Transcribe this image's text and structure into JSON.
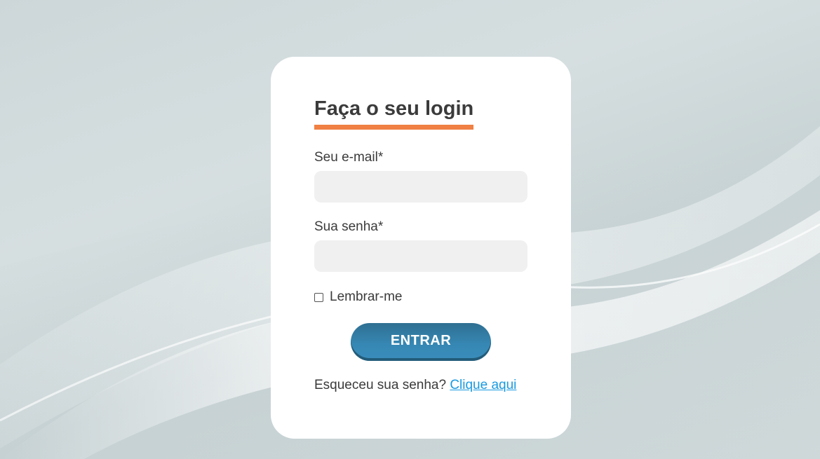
{
  "login": {
    "title": "Faça o seu login",
    "email_label": "Seu e-mail*",
    "email_value": "",
    "password_label": "Sua senha*",
    "password_value": "",
    "remember_label": "Lembrar-me",
    "remember_checked": false,
    "submit_label": "ENTRAR",
    "forgot_text": "Esqueceu sua senha?",
    "forgot_link": "Clique aqui"
  },
  "colors": {
    "accent_underline": "#f08043",
    "button": "#3687b3",
    "link": "#1a9ae0",
    "text": "#3b3b3b",
    "input_bg": "#f0f0f0"
  }
}
